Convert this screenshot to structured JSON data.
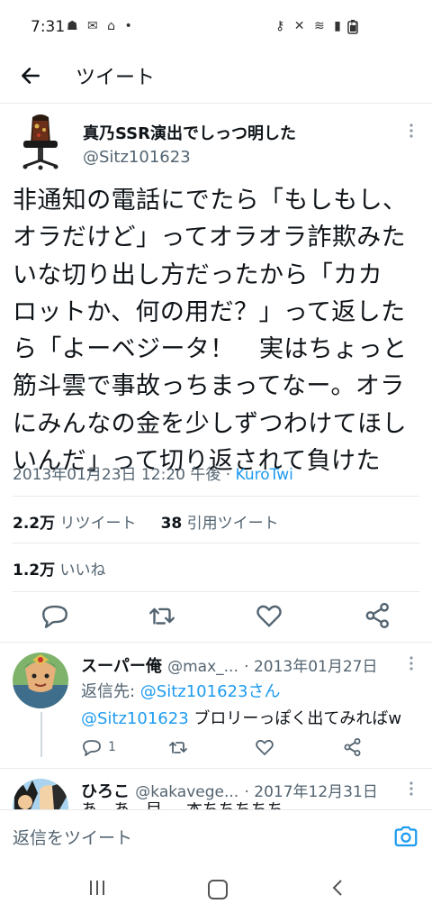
{
  "status_bar": {
    "time": "7:31",
    "notification_icons": "☗ ✉ ⌂ •",
    "system_icons": "⚷ ✕ ≋ ▮ ▯"
  },
  "header": {
    "title": "ツイート"
  },
  "tweet": {
    "display_name": "真乃SSR演出でしっつ明した",
    "handle": "@Sitz101623",
    "text_lines": [
      "非通知の電話にでたら「もしもし、",
      "オラだけど」ってオラオラ詐欺みた",
      "いな切り出し方だったから「カカ",
      "ロットか、何の用だ？」って返した",
      "ら「よーベジータ！　実はちょっと",
      "筋斗雲で事故っちまってなー。オラ",
      "にみんなの金を少しずつわけてほし",
      "いんだ」って切り返されて負けた"
    ],
    "timestamp": "2013年01月23日 12:20 午後",
    "separator": " · ",
    "via": "KuroTwi",
    "retweets_count": "2.2万",
    "retweets_label": "リツイート",
    "quotes_count": "38",
    "quotes_label": "引用ツイート",
    "likes_count": "1.2万",
    "likes_label": "いいね"
  },
  "replies": [
    {
      "name": "スーパー俺",
      "handle": "@max_...",
      "date": "· 2013年01月27日",
      "reply_to_label": "返信先: ",
      "reply_to_handle": "@Sitz101623さん",
      "mention": "@Sitz101623",
      "text": " ブロリーっぽく出てみればw",
      "reply_count": "1"
    },
    {
      "name": "ひろこ",
      "handle": "@kakavege...",
      "date": "· 2017年12月31日",
      "partial_text": "あ、あ、目、、本ちちちちち"
    }
  ],
  "composer": {
    "placeholder": "返信をツイート"
  },
  "colors": {
    "accent": "#1d9bf0",
    "secondary_text": "#536471",
    "divider": "#e7e9ea"
  }
}
